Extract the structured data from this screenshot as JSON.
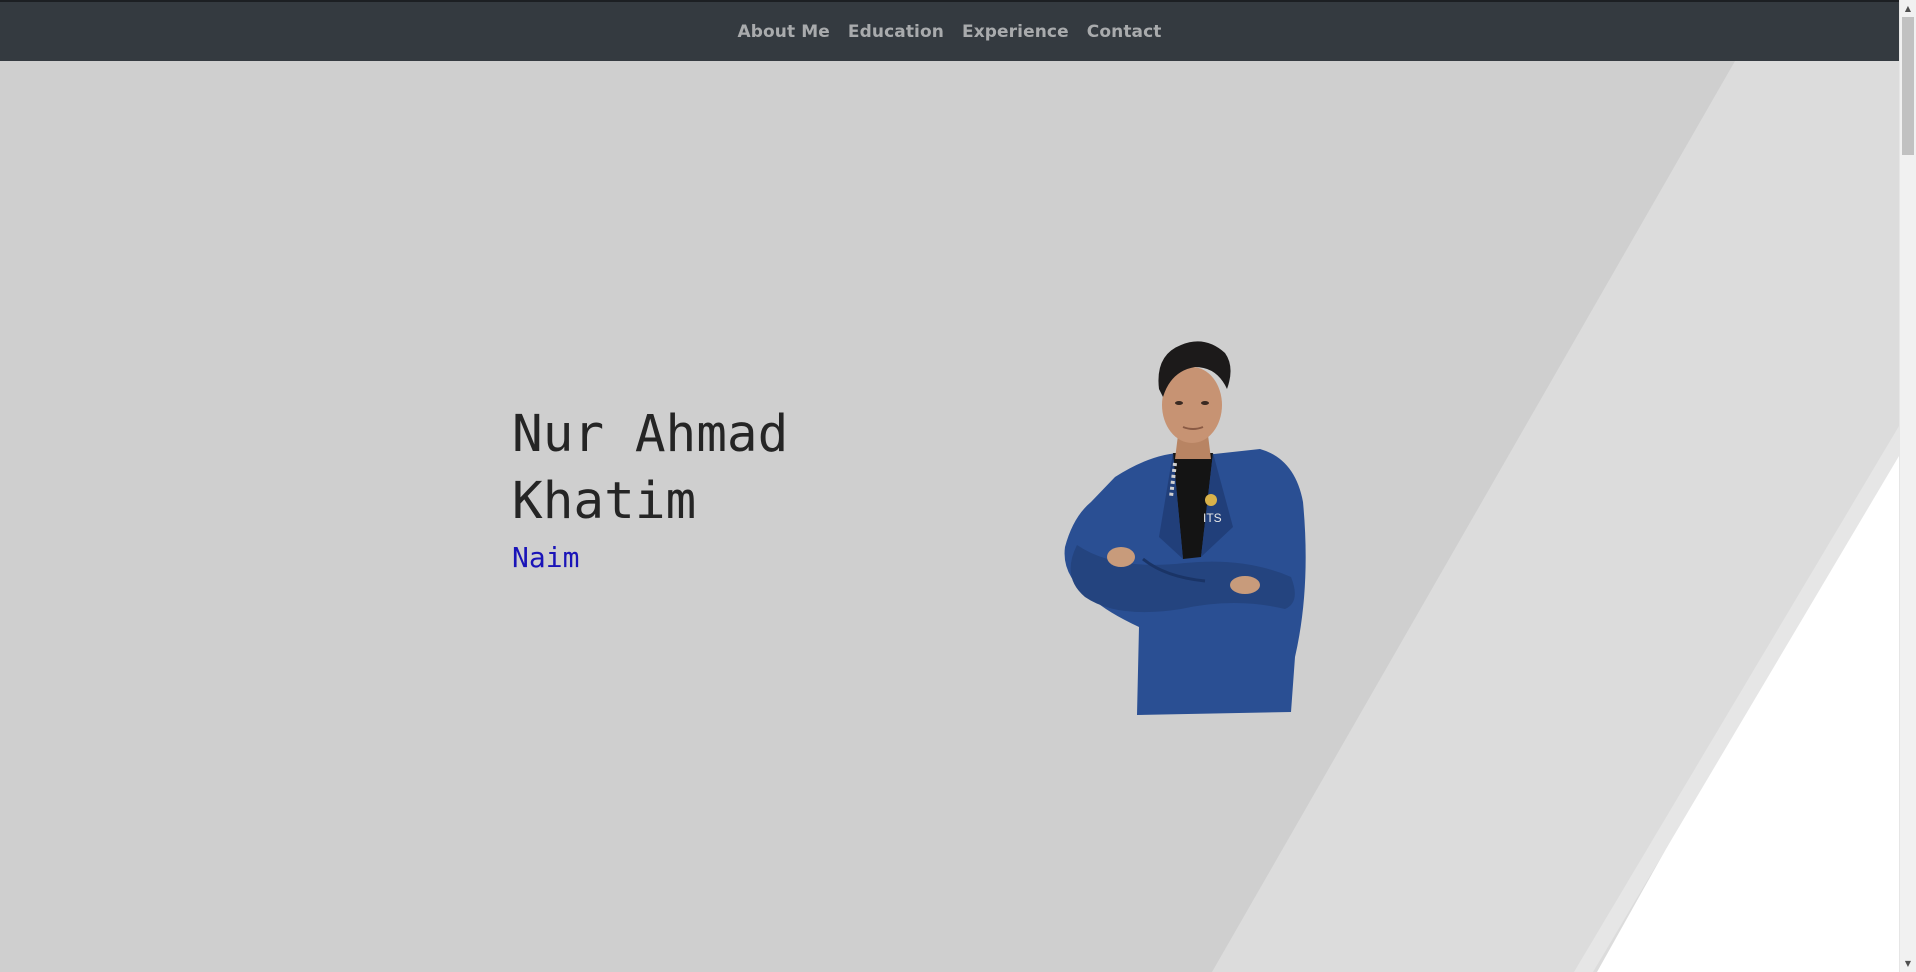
{
  "nav": {
    "items": [
      {
        "label": "About Me"
      },
      {
        "label": "Education"
      },
      {
        "label": "Experience"
      },
      {
        "label": "Contact"
      }
    ]
  },
  "hero": {
    "name_line1": "Nur Ahmad",
    "name_line2": "Khatim",
    "nickname": "Naim",
    "portrait_badge": "ITS"
  },
  "colors": {
    "navbar": "#343a40",
    "nav_text": "#a9abad",
    "hero_bg": "#cfcfcf",
    "stripe_light": "#dcdcdc",
    "name_text": "#252525",
    "nickname_text": "#1a14b8",
    "blazer": "#2a4f93"
  },
  "icons": {
    "scroll_up": "triangle-up",
    "scroll_down": "triangle-down"
  }
}
